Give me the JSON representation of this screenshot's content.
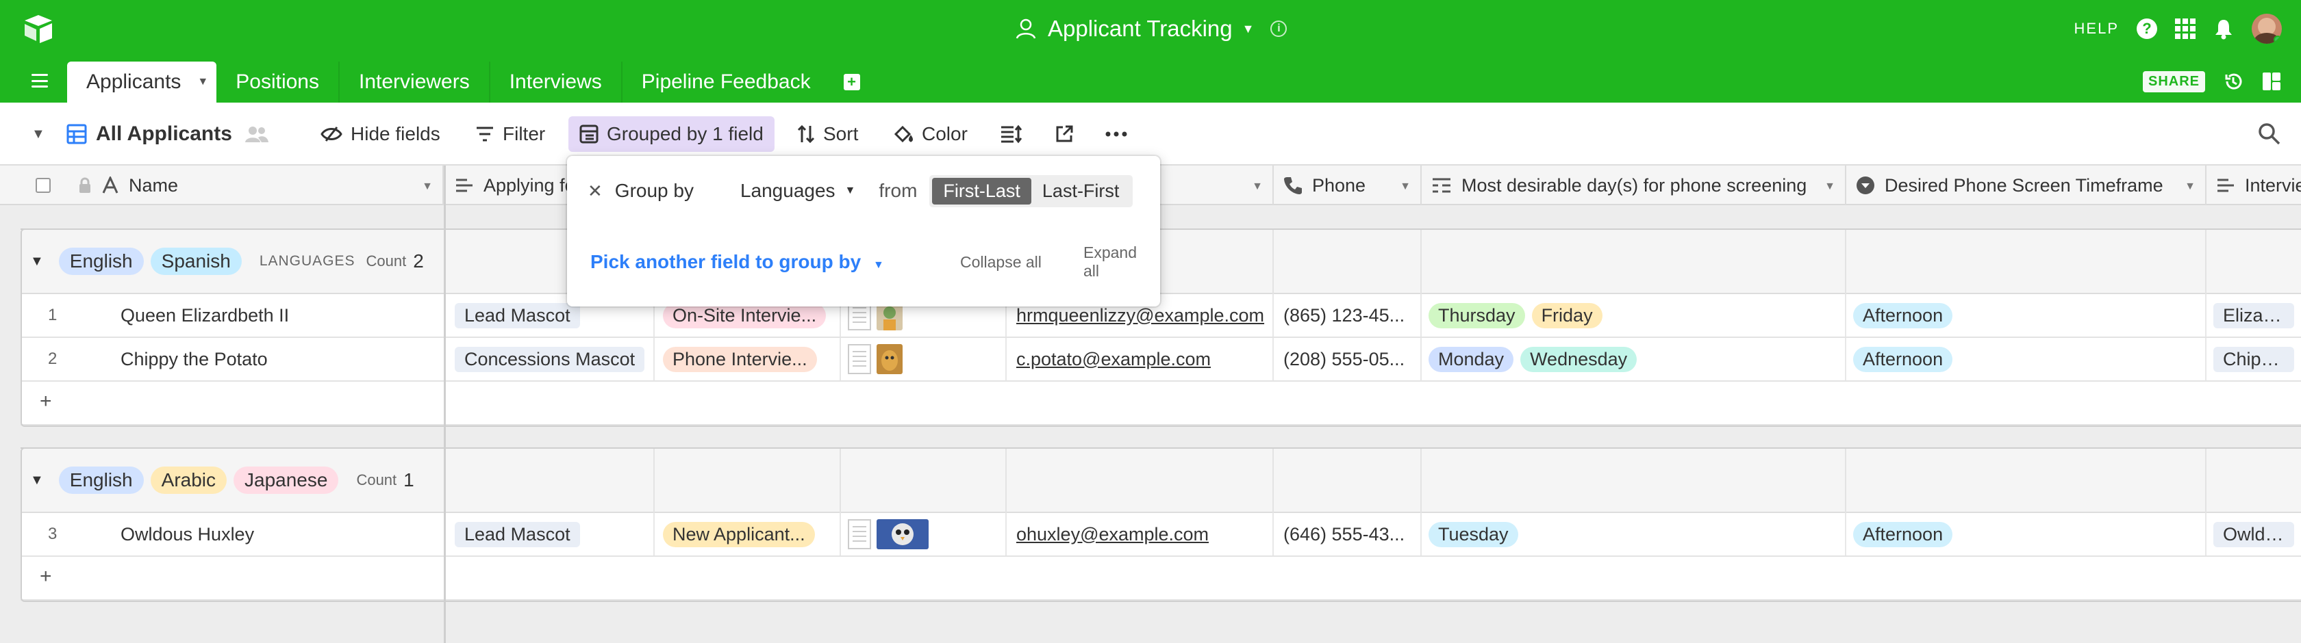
{
  "app": {
    "title": "Applicant Tracking",
    "help_label": "HELP",
    "share_label": "SHARE"
  },
  "tabs": [
    {
      "label": "Applicants"
    },
    {
      "label": "Positions"
    },
    {
      "label": "Interviewers"
    },
    {
      "label": "Interviews"
    },
    {
      "label": "Pipeline Feedback"
    }
  ],
  "viewbar": {
    "view_name": "All Applicants",
    "hide_fields": "Hide fields",
    "filter": "Filter",
    "grouped": "Grouped by 1 field",
    "sort": "Sort",
    "color": "Color"
  },
  "columns": {
    "name": "Name",
    "applying_for": "Applying fo",
    "phone": "Phone",
    "desirable_days": "Most desirable day(s) for phone screening",
    "timeframe": "Desired Phone Screen Timeframe",
    "interviewer": "Intervie"
  },
  "popover": {
    "group_by": "Group by",
    "field": "Languages",
    "from": "from",
    "order_a": "First-Last",
    "order_b": "Last-First",
    "pick_another": "Pick another field to group by",
    "collapse_all": "Collapse all",
    "expand_all": "Expand all"
  },
  "groups": [
    {
      "languages": [
        "English",
        "Spanish"
      ],
      "field_label": "LANGUAGES",
      "count_label": "Count",
      "count": "2",
      "rows": [
        {
          "num": "1",
          "name": "Queen Elizardbeth II",
          "applying": "Lead Mascot",
          "stage": "On-Site Intervie...",
          "email": "hrmqueenlizzy@example.com",
          "phone": "(865) 123-45...",
          "days": [
            "Thursday",
            "Friday"
          ],
          "timeframe": "Afternoon",
          "interviewer": "Elizardbet"
        },
        {
          "num": "2",
          "name": "Chippy the Potato",
          "applying": "Concessions Mascot",
          "stage": "Phone Intervie...",
          "email": "c.potato@example.com",
          "phone": "(208) 555-05...",
          "days": [
            "Monday",
            "Wednesday"
          ],
          "timeframe": "Afternoon",
          "interviewer": "Chippy on"
        }
      ]
    },
    {
      "languages": [
        "English",
        "Arabic",
        "Japanese"
      ],
      "field_label": "",
      "count_label": "Count",
      "count": "1",
      "rows": [
        {
          "num": "3",
          "name": "Owldous Huxley",
          "applying": "Lead Mascot",
          "stage": "New Applicant...",
          "email": "ohuxley@example.com",
          "phone": "(646) 555-43...",
          "days": [
            "Tuesday"
          ],
          "timeframe": "Afternoon",
          "interviewer": "Owldous o"
        }
      ]
    }
  ],
  "add_row_label": "+",
  "colors": {
    "brand_green": "#1fb61f",
    "lang_english": "#d1e2ff",
    "lang_spanish": "#c4ecff",
    "lang_arabic": "#ffeab6",
    "lang_japanese": "#ffdce5",
    "stage_onsite": "#ffdce5",
    "stage_phone": "#fee2d5",
    "stage_new": "#ffeab6",
    "day_thursday": "#d1f7c4",
    "day_friday": "#ffeab6",
    "day_monday": "#cfdfff",
    "day_wednesday": "#c2f5e9",
    "day_tuesday": "#d0f0fd",
    "timeframe_afternoon": "#d0f0fd"
  }
}
